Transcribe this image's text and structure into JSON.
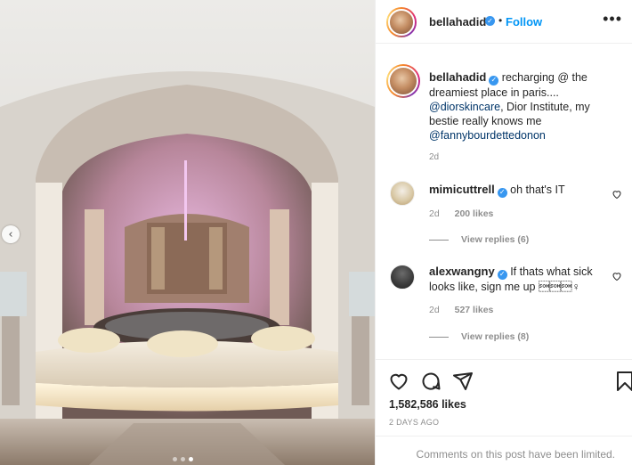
{
  "post": {
    "carousel": {
      "current_index": 2,
      "total": 3
    }
  },
  "header": {
    "username": "bellahadid",
    "separator": "•",
    "follow_label": "Follow",
    "more_label": "•••"
  },
  "caption": {
    "username": "bellahadid",
    "text_1": "recharging @ the dreamiest place in paris....",
    "mention_1": "@diorskincare",
    "text_2": ", Dior Institute, my bestie really knows me",
    "mention_2": "@fannybourdettedonon",
    "time": "2d"
  },
  "comments": [
    {
      "username": "mimicuttrell",
      "text": "oh that's IT",
      "time": "2d",
      "likes": "200 likes",
      "replies": "View replies (6)"
    },
    {
      "username": "alexwangny",
      "text": "If thats what sick looks like, sign me up \u0001\u0001\u0001♀",
      "time": "2d",
      "likes": "527 likes",
      "replies": "View replies (8)"
    }
  ],
  "footer": {
    "likes": "1,582,586 likes",
    "date": "2 DAYS AGO",
    "comments_limited": "Comments on this post have been limited."
  },
  "icons": {
    "verified": "verified-badge-icon",
    "heart": "heart-icon",
    "comment": "comment-icon",
    "share": "share-icon",
    "save": "bookmark-icon"
  },
  "colors": {
    "link_blue": "#0095f6",
    "mention": "#003569",
    "verified": "#3897f0",
    "muted": "#8e8e8e"
  }
}
